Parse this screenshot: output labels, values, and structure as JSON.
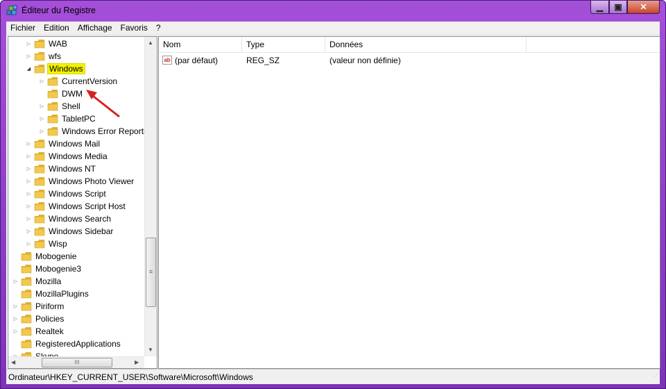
{
  "window": {
    "title": "Éditeur du Registre",
    "min_glyph": "▁",
    "max_glyph": "▣",
    "close_glyph": "✕"
  },
  "menu": [
    "Fichier",
    "Edition",
    "Affichage",
    "Favoris",
    "?"
  ],
  "tree": {
    "selected": "Windows",
    "items": [
      {
        "label": "WAB",
        "depth": 1,
        "expandable": true,
        "expanded": false
      },
      {
        "label": "wfs",
        "depth": 1,
        "expandable": true,
        "expanded": false
      },
      {
        "label": "Windows",
        "depth": 1,
        "expandable": true,
        "expanded": true,
        "selected": true
      },
      {
        "label": "CurrentVersion",
        "depth": 2,
        "expandable": true,
        "expanded": false
      },
      {
        "label": "DWM",
        "depth": 2,
        "expandable": false
      },
      {
        "label": "Shell",
        "depth": 2,
        "expandable": true,
        "expanded": false
      },
      {
        "label": "TabletPC",
        "depth": 2,
        "expandable": true,
        "expanded": false
      },
      {
        "label": "Windows Error Reporting",
        "depth": 2,
        "expandable": true,
        "expanded": false
      },
      {
        "label": "Windows Mail",
        "depth": 1,
        "expandable": true,
        "expanded": false
      },
      {
        "label": "Windows Media",
        "depth": 1,
        "expandable": true,
        "expanded": false
      },
      {
        "label": "Windows NT",
        "depth": 1,
        "expandable": true,
        "expanded": false
      },
      {
        "label": "Windows Photo Viewer",
        "depth": 1,
        "expandable": true,
        "expanded": false
      },
      {
        "label": "Windows Script",
        "depth": 1,
        "expandable": true,
        "expanded": false
      },
      {
        "label": "Windows Script Host",
        "depth": 1,
        "expandable": true,
        "expanded": false
      },
      {
        "label": "Windows Search",
        "depth": 1,
        "expandable": true,
        "expanded": false
      },
      {
        "label": "Windows Sidebar",
        "depth": 1,
        "expandable": true,
        "expanded": false
      },
      {
        "label": "Wisp",
        "depth": 1,
        "expandable": true,
        "expanded": false
      },
      {
        "label": "Mobogenie",
        "depth": 0,
        "expandable": false
      },
      {
        "label": "Mobogenie3",
        "depth": 0,
        "expandable": false
      },
      {
        "label": "Mozilla",
        "depth": 0,
        "expandable": true,
        "expanded": false
      },
      {
        "label": "MozillaPlugins",
        "depth": 0,
        "expandable": false
      },
      {
        "label": "Piriform",
        "depth": 0,
        "expandable": true,
        "expanded": false
      },
      {
        "label": "Policies",
        "depth": 0,
        "expandable": true,
        "expanded": false
      },
      {
        "label": "Realtek",
        "depth": 0,
        "expandable": true,
        "expanded": false
      },
      {
        "label": "RegisteredApplications",
        "depth": 0,
        "expandable": false
      },
      {
        "label": "Skype",
        "depth": 0,
        "expandable": true,
        "expanded": false
      }
    ],
    "vscroll_up": "▲",
    "vscroll_down": "▼",
    "vscroll_grip": "≡",
    "hscroll_left": "◀",
    "hscroll_right": "▶",
    "hscroll_grip": "III"
  },
  "list": {
    "columns": [
      "Nom",
      "Type",
      "Données"
    ],
    "rows": [
      {
        "icon": "string-value-icon",
        "icon_text": "ab",
        "name": "(par défaut)",
        "type": "REG_SZ",
        "data": "(valeur non définie)"
      }
    ]
  },
  "statusbar": {
    "path": "Ordinateur\\HKEY_CURRENT_USER\\Software\\Microsoft\\Windows",
    "grip": "⋰"
  },
  "colors": {
    "selection_highlight": "#f2f200",
    "annotation_arrow": "#d82020",
    "folder": "#f2c94c"
  }
}
